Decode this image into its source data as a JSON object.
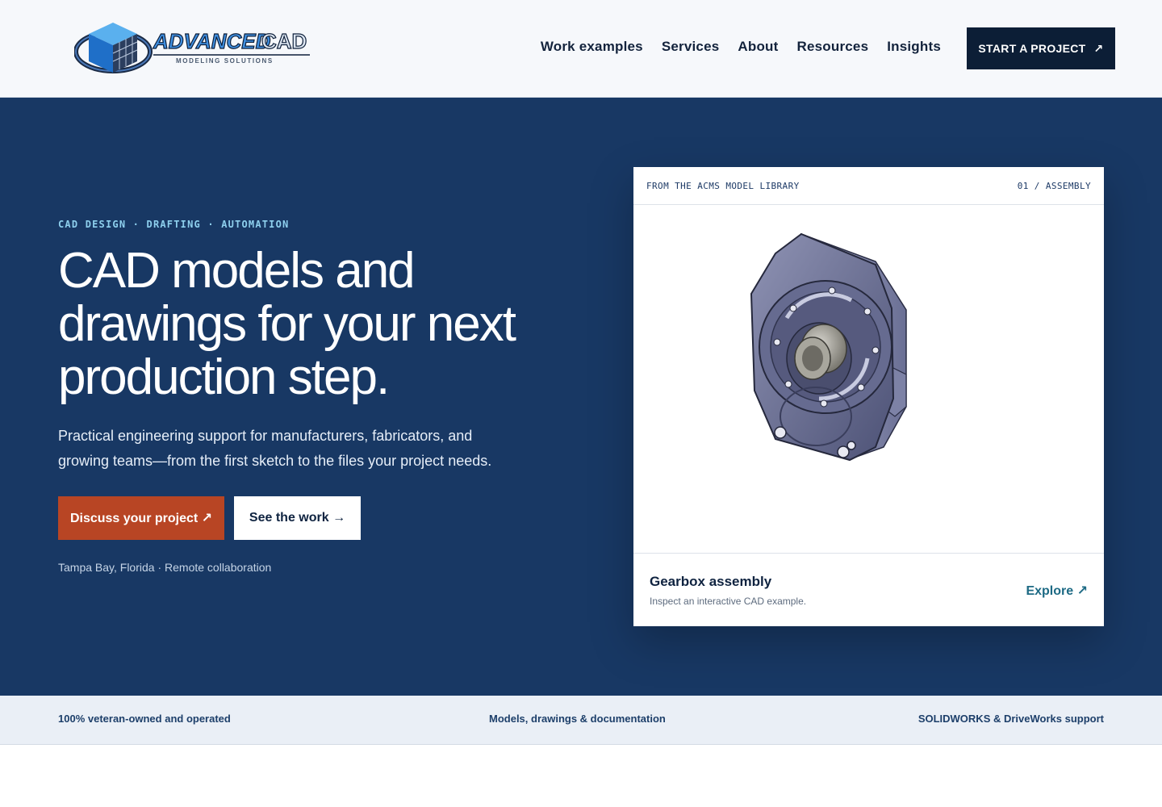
{
  "logo": {
    "word1": "ADVANCED",
    "word2": "CAD",
    "tagline": "MODELING SOLUTIONS"
  },
  "nav": [
    {
      "label": "Work examples"
    },
    {
      "label": "Services"
    },
    {
      "label": "About"
    },
    {
      "label": "Resources"
    },
    {
      "label": "Insights"
    }
  ],
  "header_cta": {
    "label": "START A PROJECT",
    "icon": "↗"
  },
  "hero": {
    "eyebrow": "CAD DESIGN · DRAFTING · AUTOMATION",
    "headline": "CAD models and drawings for your next production step.",
    "subtext": "Practical engineering support for manufacturers, fabricators, and growing teams—from the first sketch to the files your project needs.",
    "primary_button": "Discuss your project ↗",
    "secondary_button": "See the work →",
    "location": "Tampa Bay, Florida · Remote collaboration"
  },
  "card": {
    "label_left": "FROM THE ACMS MODEL LIBRARY",
    "label_right": "01 / ASSEMBLY",
    "title": "Gearbox assembly",
    "description": "Inspect an interactive CAD example.",
    "link": "Explore ↗"
  },
  "strip": {
    "left": "100% veteran-owned and operated",
    "center": "Models, drawings & documentation",
    "right": "SOLIDWORKS & DriveWorks support"
  },
  "colors": {
    "hero_bg": "#183864",
    "primary_button": "#b84524",
    "header_cta_bg": "#0c1e36",
    "accent_link": "#1d6a84",
    "eyebrow": "#8ed0ee"
  }
}
